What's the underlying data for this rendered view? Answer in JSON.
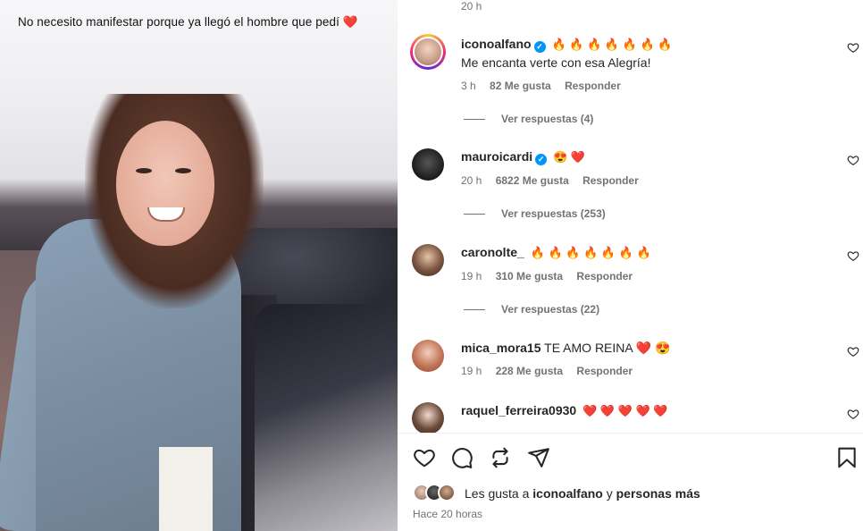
{
  "media": {
    "caption": "No necesito manifestar porque ya llegó el hombre que pedí",
    "caption_emoji": "❤️"
  },
  "comments_top_time": "20 h",
  "comments": [
    {
      "username": "iconoalfano",
      "verified": true,
      "text": "🔥 🔥 🔥 🔥 🔥 🔥 🔥",
      "text2": "Me encanta verte con esa Alegría!",
      "time": "3 h",
      "likes": "82 Me gusta",
      "reply": "Responder",
      "view_replies": "Ver respuestas (4)"
    },
    {
      "username": "mauroicardi",
      "verified": true,
      "text": "😍 ❤️",
      "time": "20 h",
      "likes": "6822 Me gusta",
      "reply": "Responder",
      "view_replies": "Ver respuestas (253)"
    },
    {
      "username": "caronolte_",
      "verified": false,
      "text": "🔥 🔥 🔥 🔥 🔥 🔥 🔥",
      "time": "19 h",
      "likes": "310 Me gusta",
      "reply": "Responder",
      "view_replies": "Ver respuestas (22)"
    },
    {
      "username": "mica_mora15",
      "verified": false,
      "text": "TE AMO REINA ❤️ 😍",
      "time": "19 h",
      "likes": "228 Me gusta",
      "reply": "Responder"
    },
    {
      "username": "raquel_ferreira0930",
      "verified": false,
      "text": "❤️ ❤️ ❤️ ❤️ ❤️"
    }
  ],
  "likes": {
    "prefix": "Les gusta a",
    "user": "iconoalfano",
    "connector": "y",
    "suffix": "personas más"
  },
  "posted": "Hace 20 horas",
  "colors": {
    "verified": "#0095f6",
    "secondary_text": "#737373",
    "primary_text": "#262626"
  },
  "icons": [
    "heart-icon",
    "comment-icon",
    "repost-icon",
    "share-icon",
    "bookmark-icon"
  ]
}
